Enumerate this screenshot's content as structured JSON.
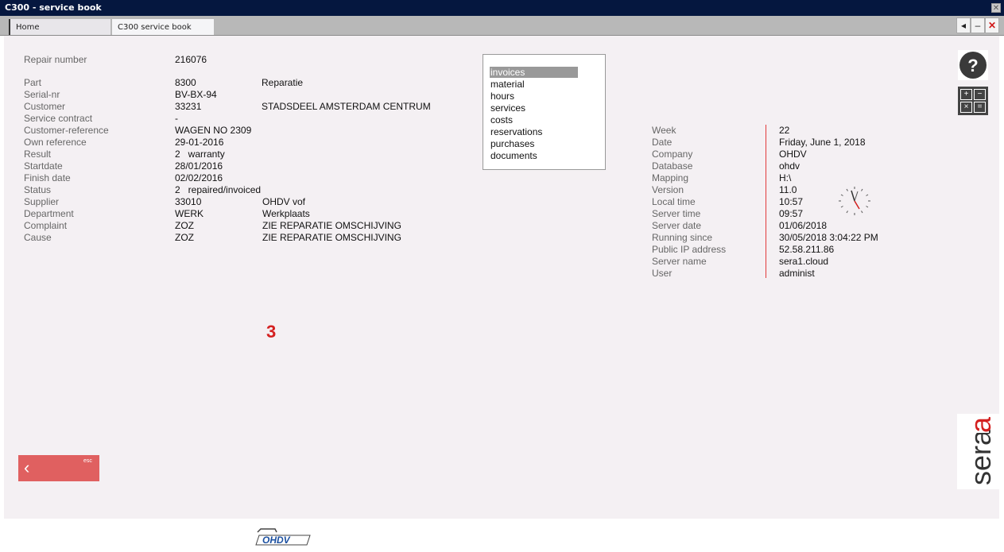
{
  "window": {
    "title": "C300 - service book",
    "close_glyph": "✕"
  },
  "tabs": [
    {
      "label": "Home"
    },
    {
      "label": "C300 service book"
    }
  ],
  "tab_controls": {
    "prev": "◂",
    "minimize": "–",
    "close": "✕"
  },
  "fields": [
    {
      "label": "Repair number",
      "value": "216076",
      "extra": ""
    },
    {
      "label": "Part",
      "value": "8300",
      "extra": "Reparatie"
    },
    {
      "label": "Serial-nr",
      "value": "BV-BX-94",
      "extra": ""
    },
    {
      "label": "Customer",
      "value": "33231",
      "extra": "STADSDEEL AMSTERDAM CENTRUM"
    },
    {
      "label": "Service contract",
      "value": "-",
      "extra": ""
    },
    {
      "label": "Customer-reference",
      "value": "WAGEN NO 2309",
      "extra": ""
    },
    {
      "label": "Own reference",
      "value": "29-01-2016",
      "extra": ""
    },
    {
      "label": "Result",
      "value": "2   warranty",
      "extra": ""
    },
    {
      "label": "Startdate",
      "value": "28/01/2016",
      "extra": ""
    },
    {
      "label": "Finish date",
      "value": "02/02/2016",
      "extra": ""
    },
    {
      "label": "Status",
      "value": "2   repaired/invoiced",
      "extra": ""
    },
    {
      "label": "Supplier",
      "value": "33010",
      "extra": "OHDV vof"
    },
    {
      "label": "Department",
      "value": "WERK",
      "extra": "Werkplaats"
    },
    {
      "label": "Complaint",
      "value": "ZOZ",
      "extra": "ZIE REPARATIE OMSCHIJVING"
    },
    {
      "label": "Cause",
      "value": "ZOZ",
      "extra": "ZIE REPARATIE OMSCHIJVING"
    }
  ],
  "menu": {
    "items": [
      "invoices",
      "material",
      "hours",
      "services",
      "costs",
      "reservations",
      "purchases",
      "documents"
    ],
    "selected": "invoices"
  },
  "info": [
    {
      "label": "Week",
      "value": "22"
    },
    {
      "label": "Date",
      "value": "Friday, June 1, 2018"
    },
    {
      "label": "Company",
      "value": "OHDV"
    },
    {
      "label": "Database",
      "value": "ohdv"
    },
    {
      "label": "Mapping",
      "value": "H:\\"
    },
    {
      "label": "Version",
      "value": "11.0"
    },
    {
      "label": "Local time",
      "value": "10:57"
    },
    {
      "label": "Server time",
      "value": "09:57"
    },
    {
      "label": "Server date",
      "value": "01/06/2018"
    },
    {
      "label": "Running since",
      "value": "30/05/2018 3:04:22 PM"
    },
    {
      "label": "Public IP address",
      "value": "52.58.211.86"
    },
    {
      "label": "Server name",
      "value": "sera1.cloud"
    },
    {
      "label": "User",
      "value": "administ"
    }
  ],
  "big_number": "3",
  "help": {
    "glyph": "?"
  },
  "calc": {
    "keys": [
      "+",
      "−",
      "×",
      "="
    ]
  },
  "back": {
    "arrow": "‹",
    "esc": "esc"
  },
  "brand": {
    "sera": "sera",
    "logo": "OHDV"
  },
  "colors": {
    "accent": "#e06060",
    "titlebar": "#05173f",
    "brand_red": "#d42020"
  }
}
